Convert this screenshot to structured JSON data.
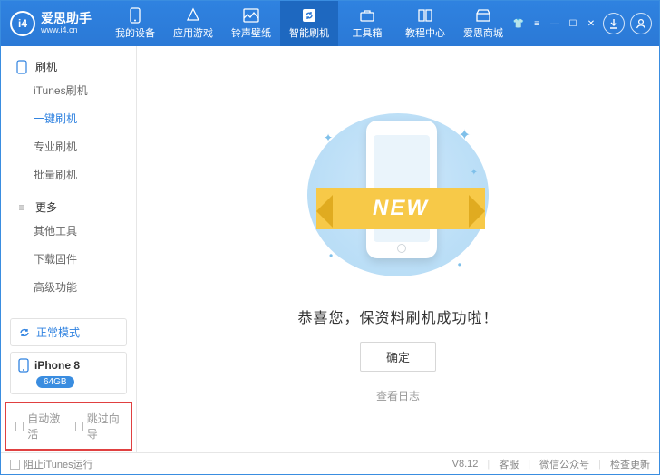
{
  "brand": {
    "logo": "i4",
    "title": "爱思助手",
    "url": "www.i4.cn"
  },
  "nav": [
    {
      "id": "devices",
      "label": "我的设备"
    },
    {
      "id": "apps",
      "label": "应用游戏"
    },
    {
      "id": "ringtones",
      "label": "铃声壁纸"
    },
    {
      "id": "flash",
      "label": "智能刷机",
      "active": true
    },
    {
      "id": "toolbox",
      "label": "工具箱"
    },
    {
      "id": "tutorials",
      "label": "教程中心"
    },
    {
      "id": "store",
      "label": "爱思商城"
    }
  ],
  "sidebar": {
    "group1": {
      "title": "刷机"
    },
    "items1": [
      {
        "id": "itunes",
        "label": "iTunes刷机"
      },
      {
        "id": "onekey",
        "label": "一键刷机",
        "active": true
      },
      {
        "id": "pro",
        "label": "专业刷机"
      },
      {
        "id": "batch",
        "label": "批量刷机"
      }
    ],
    "group2": {
      "title": "更多"
    },
    "items2": [
      {
        "id": "other",
        "label": "其他工具"
      },
      {
        "id": "firmware",
        "label": "下载固件"
      },
      {
        "id": "advanced",
        "label": "高级功能"
      }
    ],
    "mode": {
      "label": "正常模式"
    },
    "device": {
      "name": "iPhone 8",
      "storage": "64GB"
    },
    "checks": {
      "auto_activate": "自动激活",
      "skip_guide": "跳过向导"
    }
  },
  "main": {
    "ribbon": "NEW",
    "message": "恭喜您，保资料刷机成功啦！",
    "ok": "确定",
    "log": "查看日志"
  },
  "footer": {
    "block_itunes": "阻止iTunes运行",
    "version": "V8.12",
    "support": "客服",
    "wechat": "微信公众号",
    "update": "检查更新"
  }
}
